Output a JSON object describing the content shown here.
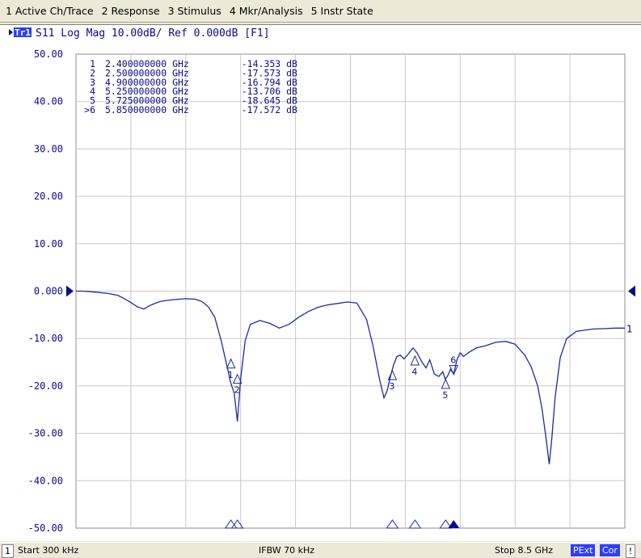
{
  "menu": [
    {
      "label": "1 Active Ch/Trace"
    },
    {
      "label": "2 Response"
    },
    {
      "label": "3 Stimulus"
    },
    {
      "label": "4 Mkr/Analysis"
    },
    {
      "label": "5 Instr State"
    }
  ],
  "trace_header": {
    "trace_badge": "Tr1",
    "text": "S11 Log Mag 10.00dB/ Ref 0.000dB [F1]"
  },
  "colors": {
    "trace": "#1a2c9c",
    "grid": "#c8c8c8",
    "text": "#0a0a8c",
    "badge": "#2d3cff"
  },
  "status": {
    "channel": "1",
    "start": "Start 300 kHz",
    "ifbw": "IFBW 70 kHz",
    "stop": "Stop 8.5 GHz",
    "pext": "PExt",
    "cor": "Cor",
    "alert": "!"
  },
  "chart_data": {
    "type": "line",
    "title": "S11 Log Mag 10.00dB/ Ref 0.000dB [F1]",
    "xlabel": "",
    "ylabel": "",
    "xlim": [
      0.0003,
      8.5
    ],
    "ylim": [
      -50,
      50
    ],
    "grid": true,
    "yticks": [
      "50.00",
      "40.00",
      "30.00",
      "20.00",
      "10.00",
      "0.000",
      "-10.00",
      "-20.00",
      "-30.00",
      "-40.00",
      "-50.00"
    ],
    "ref_level": 0,
    "trace_end_label": "1",
    "series": [
      {
        "name": "S11",
        "x": [
          0.0003,
          0.1,
          0.3,
          0.5,
          0.65,
          0.75,
          0.85,
          0.95,
          1.05,
          1.15,
          1.3,
          1.5,
          1.7,
          1.85,
          1.95,
          2.05,
          2.15,
          2.25,
          2.35,
          2.4,
          2.45,
          2.5,
          2.55,
          2.62,
          2.7,
          2.85,
          3.0,
          3.15,
          3.3,
          3.45,
          3.6,
          3.75,
          3.9,
          4.05,
          4.2,
          4.35,
          4.5,
          4.6,
          4.7,
          4.77,
          4.82,
          4.87,
          4.92,
          4.97,
          5.02,
          5.08,
          5.15,
          5.22,
          5.28,
          5.35,
          5.42,
          5.48,
          5.55,
          5.62,
          5.68,
          5.72,
          5.76,
          5.8,
          5.85,
          5.9,
          5.95,
          6.0,
          6.1,
          6.2,
          6.35,
          6.5,
          6.65,
          6.8,
          6.95,
          7.05,
          7.15,
          7.22,
          7.28,
          7.33,
          7.37,
          7.42,
          7.5,
          7.6,
          7.75,
          8.0,
          8.2,
          8.35,
          8.5
        ],
        "values": [
          0.0,
          0.0,
          -0.2,
          -0.5,
          -0.9,
          -1.6,
          -2.4,
          -3.3,
          -3.8,
          -3.0,
          -2.2,
          -1.8,
          -1.6,
          -1.7,
          -2.2,
          -3.3,
          -5.5,
          -10.5,
          -16.5,
          -19.5,
          -21.5,
          -27.5,
          -18.5,
          -10.5,
          -7.0,
          -6.2,
          -6.8,
          -7.8,
          -7.0,
          -5.5,
          -4.3,
          -3.4,
          -2.9,
          -2.6,
          -2.3,
          -2.5,
          -6.0,
          -11.5,
          -18.5,
          -22.5,
          -21.0,
          -18.0,
          -15.5,
          -13.8,
          -13.5,
          -14.3,
          -13.2,
          -12.0,
          -13.0,
          -14.8,
          -16.2,
          -14.5,
          -17.5,
          -18.0,
          -17.0,
          -18.6,
          -17.8,
          -16.5,
          -17.5,
          -14.5,
          -13.0,
          -13.8,
          -12.8,
          -12.0,
          -11.5,
          -10.8,
          -10.6,
          -11.2,
          -13.5,
          -16.0,
          -20.0,
          -25.0,
          -31.0,
          -36.5,
          -31.0,
          -22.5,
          -14.0,
          -10.0,
          -8.5,
          -8.0,
          -7.9,
          -7.8,
          -7.8
        ]
      }
    ],
    "markers": [
      {
        "id": "1",
        "label": "1",
        "prefix": "",
        "freq": 2.4,
        "freq_text": "2.400000000 GHz",
        "value": -14.353,
        "value_text": "-14.353 dB",
        "shape": "up",
        "active": false
      },
      {
        "id": "2",
        "label": "2",
        "prefix": "",
        "freq": 2.5,
        "freq_text": "2.500000000 GHz",
        "value": -17.573,
        "value_text": "-17.573 dB",
        "shape": "up",
        "active": false
      },
      {
        "id": "3",
        "label": "3",
        "prefix": "",
        "freq": 4.9,
        "freq_text": "4.900000000 GHz",
        "value": -16.794,
        "value_text": "-16.794 dB",
        "shape": "up",
        "active": false
      },
      {
        "id": "4",
        "label": "4",
        "prefix": "",
        "freq": 5.25,
        "freq_text": "5.250000000 GHz",
        "value": -13.706,
        "value_text": "-13.706 dB",
        "shape": "up",
        "active": false
      },
      {
        "id": "5",
        "label": "5",
        "prefix": "",
        "freq": 5.725,
        "freq_text": "5.725000000 GHz",
        "value": -18.645,
        "value_text": "-18.645 dB",
        "shape": "up",
        "active": false
      },
      {
        "id": "6",
        "label": "6",
        "prefix": ">",
        "freq": 5.85,
        "freq_text": "5.850000000 GHz",
        "value": -17.572,
        "value_text": "-17.572 dB",
        "shape": "down",
        "active": true
      }
    ]
  }
}
